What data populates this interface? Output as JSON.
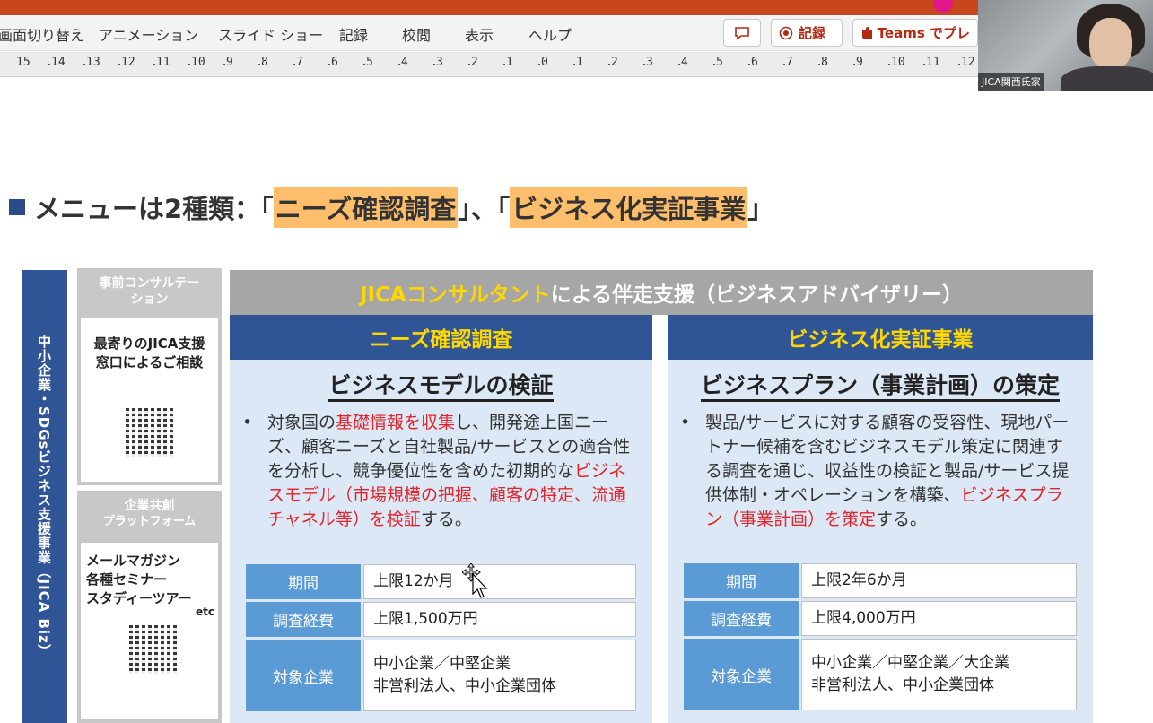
{
  "ribbon": {
    "tabs": [
      "画面切り替え",
      "アニメーション",
      "スライド ショー",
      "記録",
      "校閲",
      "表示",
      "ヘルプ"
    ],
    "record_label": "記録",
    "teams_label": "Teams でプレ"
  },
  "ruler": {
    "labels": [
      "15",
      "14",
      "13",
      "12",
      "11",
      "10",
      "9",
      "8",
      "7",
      "6",
      "5",
      "4",
      "3",
      "2",
      "1",
      "0",
      "1",
      "2",
      "3",
      "4",
      "5",
      "6",
      "7",
      "8",
      "9",
      "10",
      "11",
      "12"
    ]
  },
  "video": {
    "participant_name": "JICA関西氏家"
  },
  "slide": {
    "heading": {
      "prefix": "メニューは2種類：「",
      "hl1": "ニーズ確認調査",
      "mid": "」、「",
      "hl2": "ビジネス化実証事業",
      "suffix": "」"
    },
    "vertical_label": "中小企業・SDGsビジネス支援事業（JICA Biz）",
    "consult": {
      "header": "事前コンサルテーション",
      "body": "最寄りのJICA支援窓口によるご相談"
    },
    "platform": {
      "header_line1": "企業共創",
      "header_line2": "プラットフォーム",
      "items": [
        "メールマガジン",
        "各種セミナー",
        "スタディーツアー"
      ],
      "etc": "etc"
    },
    "top_banner": {
      "yellow": "JICAコンサルタント",
      "white": "による伴走支援（ビジネスアドバイザリー）"
    },
    "left": {
      "header": "ニーズ確認調査",
      "subtitle": "ビジネスモデルの検証",
      "body_1": "対象国の",
      "body_red1": "基礎情報を収集",
      "body_2": "し、開発途上国ニーズ、顧客ニーズと自社製品/サービスとの適合性を分析し、競争優位性を含めた初期的な",
      "body_red2": "ビジネスモデル（市場規模の把握、顧客の特定、流通チャネル等）を検証",
      "body_3": "する。",
      "rows": [
        {
          "k": "期間",
          "v1": "上限12か月",
          "v2": ""
        },
        {
          "k": "調査経費",
          "v1": "上限1,500万円",
          "v2": ""
        },
        {
          "k": "対象企業",
          "v1": "中小企業／中堅企業",
          "v2": "非営利法人、中小企業団体"
        }
      ]
    },
    "right": {
      "header": "ビジネス化実証事業",
      "subtitle": "ビジネスプラン（事業計画）の策定",
      "body_1": "製品/サービスに対する顧客の受容性、現地パートナー候補を含むビジネスモデル策定に関連する調査を通じ、収益性の検証と製品/サービス提供体制・オペレーションを構築、",
      "body_red1": "ビジネスプラン（事業計画）を策定",
      "body_2": "する。",
      "rows": [
        {
          "k": "期間",
          "v1": "上限2年6か月",
          "v2": ""
        },
        {
          "k": "調査経費",
          "v1": "上限4,000万円",
          "v2": ""
        },
        {
          "k": "対象企業",
          "v1": "中小企業／中堅企業／大企業",
          "v2": "非営利法人、中小企業団体"
        }
      ]
    }
  },
  "colors": {
    "navy": "#2f5597",
    "gold": "#ffd700",
    "highlight": "#ffbe6b",
    "accent_red": "#e0242a",
    "title_strip": "#c7461e"
  }
}
